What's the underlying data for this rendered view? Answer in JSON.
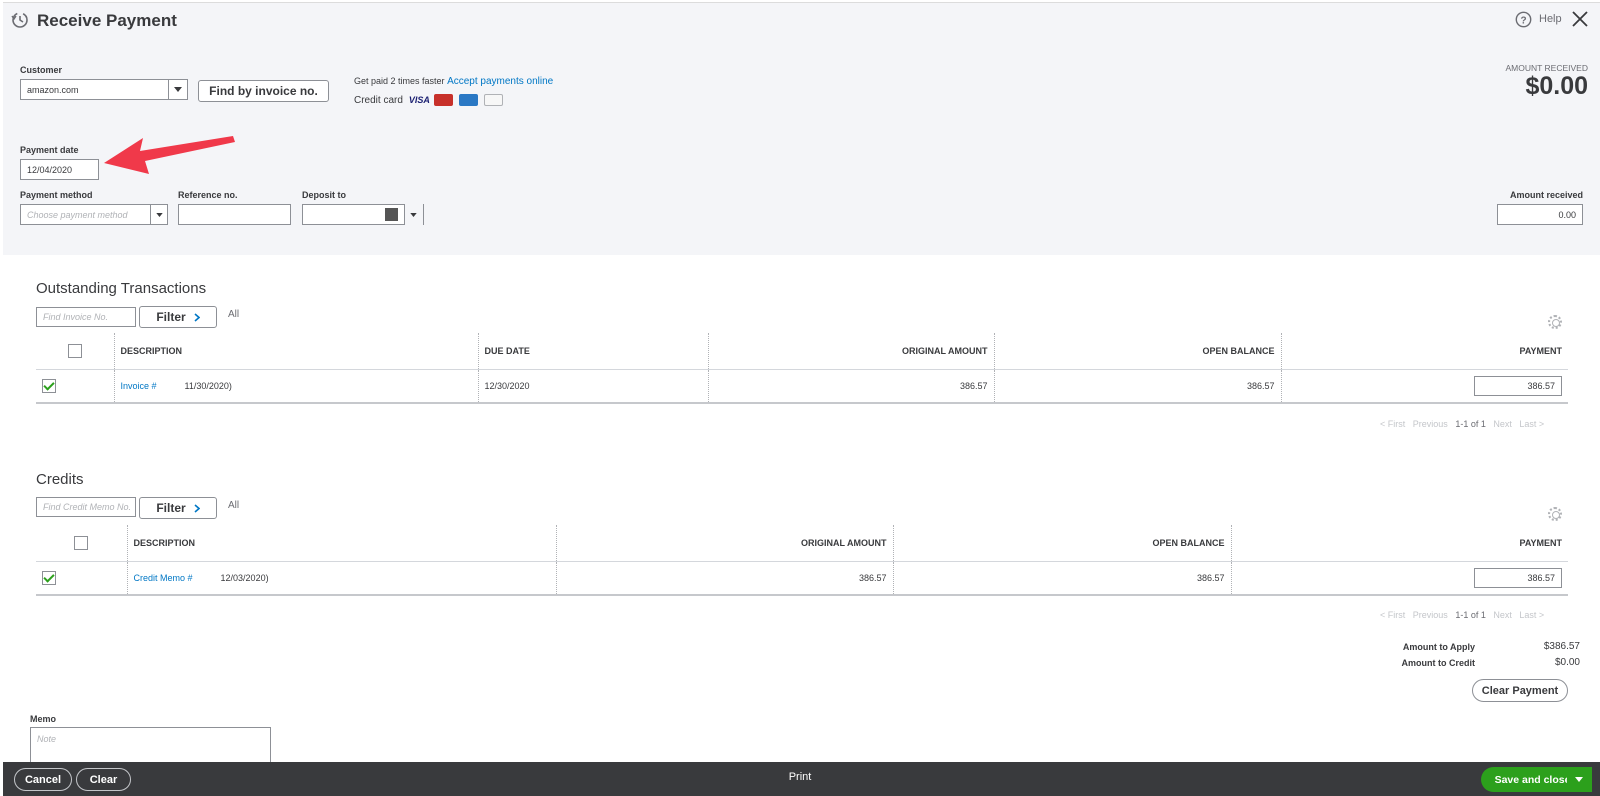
{
  "header": {
    "title": "Receive Payment",
    "help_label": "Help",
    "amount_received_label": "AMOUNT RECEIVED",
    "amount_received_value": "$0.00"
  },
  "form": {
    "customer_label": "Customer",
    "customer_value": "amazon.com",
    "find_invoice_button": "Find by invoice no.",
    "promo_text": "Get paid 2 times faster",
    "promo_link": "Accept payments online",
    "credit_card_label": "Credit card",
    "card_logos": [
      "VISA",
      "mastercard-icon",
      "amex-icon",
      "discover-icon"
    ],
    "payment_date_label": "Payment date",
    "payment_date_value": "12/04/2020",
    "payment_method_label": "Payment method",
    "payment_method_placeholder": "Choose payment method",
    "reference_label": "Reference no.",
    "reference_value": "",
    "deposit_label": "Deposit to",
    "deposit_value": "",
    "amount_received_field_label": "Amount received",
    "amount_received_field_value": "0.00"
  },
  "outstanding": {
    "title": "Outstanding Transactions",
    "search_placeholder": "Find Invoice No.",
    "filter_label": "Filter",
    "all_label": "All",
    "columns": [
      "DESCRIPTION",
      "DUE DATE",
      "ORIGINAL AMOUNT",
      "OPEN BALANCE",
      "PAYMENT"
    ],
    "rows": [
      {
        "link": "Invoice #",
        "desc": "11/30/2020)",
        "due_date": "12/30/2020",
        "original": "386.57",
        "open": "386.57",
        "payment": "386.57",
        "checked": true
      }
    ],
    "pager": {
      "first": "< First",
      "previous": "Previous",
      "range": "1-1 of 1",
      "next": "Next",
      "last": "Last >"
    }
  },
  "credits": {
    "title": "Credits",
    "search_placeholder": "Find Credit Memo No.",
    "filter_label": "Filter",
    "all_label": "All",
    "columns": [
      "DESCRIPTION",
      "ORIGINAL AMOUNT",
      "OPEN BALANCE",
      "PAYMENT"
    ],
    "rows": [
      {
        "link": "Credit Memo #",
        "desc": "12/03/2020)",
        "original": "386.57",
        "open": "386.57",
        "payment": "386.57",
        "checked": true
      }
    ],
    "pager": {
      "first": "< First",
      "previous": "Previous",
      "range": "1-1 of 1",
      "next": "Next",
      "last": "Last >"
    }
  },
  "summary": {
    "apply_label": "Amount to Apply",
    "apply_value": "$386.57",
    "credit_label": "Amount to Credit",
    "credit_value": "$0.00",
    "clear_payment": "Clear Payment"
  },
  "memo": {
    "label": "Memo",
    "placeholder": "Note"
  },
  "footer": {
    "cancel": "Cancel",
    "clear": "Clear",
    "print": "Print",
    "save": "Save and close"
  },
  "colors": {
    "accent_green": "#2ca01c",
    "link_blue": "#0077c5",
    "annotation_red": "#f0394a",
    "footer_bg": "#393a3d"
  }
}
